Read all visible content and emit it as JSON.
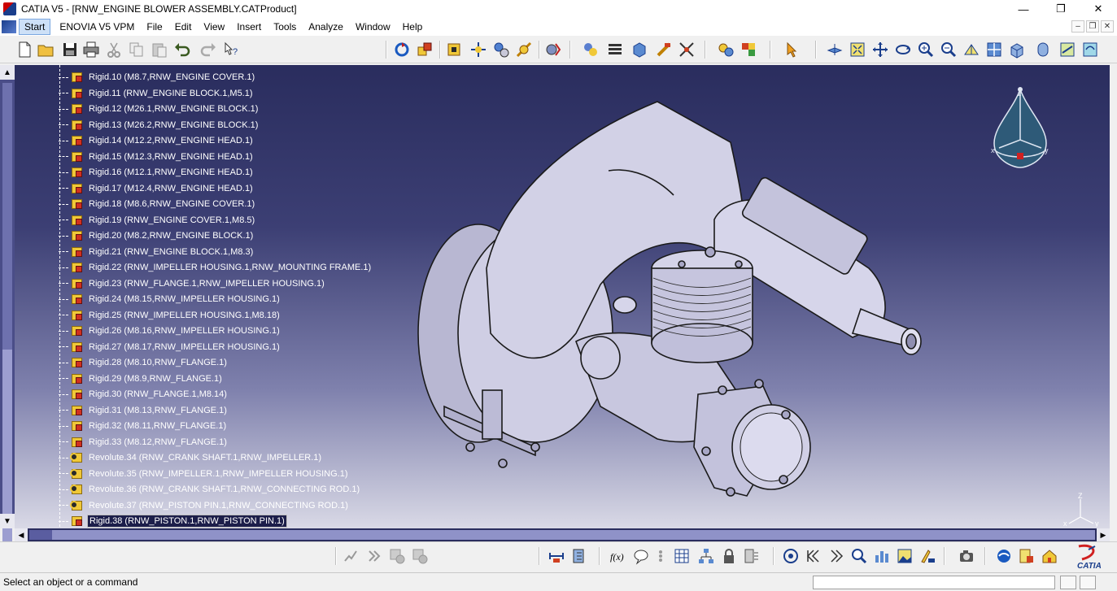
{
  "window": {
    "title": "CATIA V5 - [RNW_ENGINE BLOWER ASSEMBLY.CATProduct]",
    "minimize": "—",
    "maximize": "❐",
    "close": "✕"
  },
  "menu": {
    "items": [
      "Start",
      "ENOVIA V5 VPM",
      "File",
      "Edit",
      "View",
      "Insert",
      "Tools",
      "Analyze",
      "Window",
      "Help"
    ]
  },
  "tree": {
    "nodes": [
      {
        "label": "Rigid.10 (M8.7,RNW_ENGINE COVER.1)",
        "type": "rigid"
      },
      {
        "label": "Rigid.11 (RNW_ENGINE BLOCK.1,M5.1)",
        "type": "rigid"
      },
      {
        "label": "Rigid.12 (M26.1,RNW_ENGINE BLOCK.1)",
        "type": "rigid"
      },
      {
        "label": "Rigid.13 (M26.2,RNW_ENGINE BLOCK.1)",
        "type": "rigid"
      },
      {
        "label": "Rigid.14 (M12.2,RNW_ENGINE HEAD.1)",
        "type": "rigid"
      },
      {
        "label": "Rigid.15 (M12.3,RNW_ENGINE HEAD.1)",
        "type": "rigid"
      },
      {
        "label": "Rigid.16 (M12.1,RNW_ENGINE HEAD.1)",
        "type": "rigid"
      },
      {
        "label": "Rigid.17 (M12.4,RNW_ENGINE HEAD.1)",
        "type": "rigid"
      },
      {
        "label": "Rigid.18 (M8.6,RNW_ENGINE COVER.1)",
        "type": "rigid"
      },
      {
        "label": "Rigid.19 (RNW_ENGINE COVER.1,M8.5)",
        "type": "rigid"
      },
      {
        "label": "Rigid.20 (M8.2,RNW_ENGINE BLOCK.1)",
        "type": "rigid"
      },
      {
        "label": "Rigid.21 (RNW_ENGINE BLOCK.1,M8.3)",
        "type": "rigid"
      },
      {
        "label": "Rigid.22 (RNW_IMPELLER HOUSING.1,RNW_MOUNTING FRAME.1)",
        "type": "rigid"
      },
      {
        "label": "Rigid.23 (RNW_FLANGE.1,RNW_IMPELLER HOUSING.1)",
        "type": "rigid"
      },
      {
        "label": "Rigid.24 (M8.15,RNW_IMPELLER HOUSING.1)",
        "type": "rigid"
      },
      {
        "label": "Rigid.25 (RNW_IMPELLER HOUSING.1,M8.18)",
        "type": "rigid"
      },
      {
        "label": "Rigid.26 (M8.16,RNW_IMPELLER HOUSING.1)",
        "type": "rigid"
      },
      {
        "label": "Rigid.27 (M8.17,RNW_IMPELLER HOUSING.1)",
        "type": "rigid"
      },
      {
        "label": "Rigid.28 (M8.10,RNW_FLANGE.1)",
        "type": "rigid"
      },
      {
        "label": "Rigid.29 (M8.9,RNW_FLANGE.1)",
        "type": "rigid"
      },
      {
        "label": "Rigid.30 (RNW_FLANGE.1,M8.14)",
        "type": "rigid"
      },
      {
        "label": "Rigid.31 (M8.13,RNW_FLANGE.1)",
        "type": "rigid"
      },
      {
        "label": "Rigid.32 (M8.11,RNW_FLANGE.1)",
        "type": "rigid"
      },
      {
        "label": "Rigid.33 (M8.12,RNW_FLANGE.1)",
        "type": "rigid"
      },
      {
        "label": "Revolute.34 (RNW_CRANK SHAFT.1,RNW_IMPELLER.1)",
        "type": "revolute"
      },
      {
        "label": "Revolute.35 (RNW_IMPELLER.1,RNW_IMPELLER HOUSING.1)",
        "type": "revolute"
      },
      {
        "label": "Revolute.36 (RNW_CRANK SHAFT.1,RNW_CONNECTING ROD.1)",
        "type": "revolute"
      },
      {
        "label": "Revolute.37 (RNW_PISTON PIN.1,RNW_CONNECTING ROD.1)",
        "type": "revolute"
      },
      {
        "label": "Rigid.38 (RNW_PISTON.1,RNW_PISTON PIN.1)",
        "type": "rigid"
      }
    ]
  },
  "compass": {
    "x_label": "x",
    "y_label": "y",
    "z_label": "z"
  },
  "axis_triad": {
    "x_label": "x",
    "y_label": "y",
    "z_label": "Z"
  },
  "status": {
    "text": "Select an object or a command",
    "command_value": ""
  },
  "logo": {
    "text": "CATIA"
  },
  "colors": {
    "background_top": "#2a2d5e",
    "background_bottom": "#d9d9e6",
    "part_fill": "#c9c8e0",
    "selection_accent": "#1c1e4a"
  }
}
